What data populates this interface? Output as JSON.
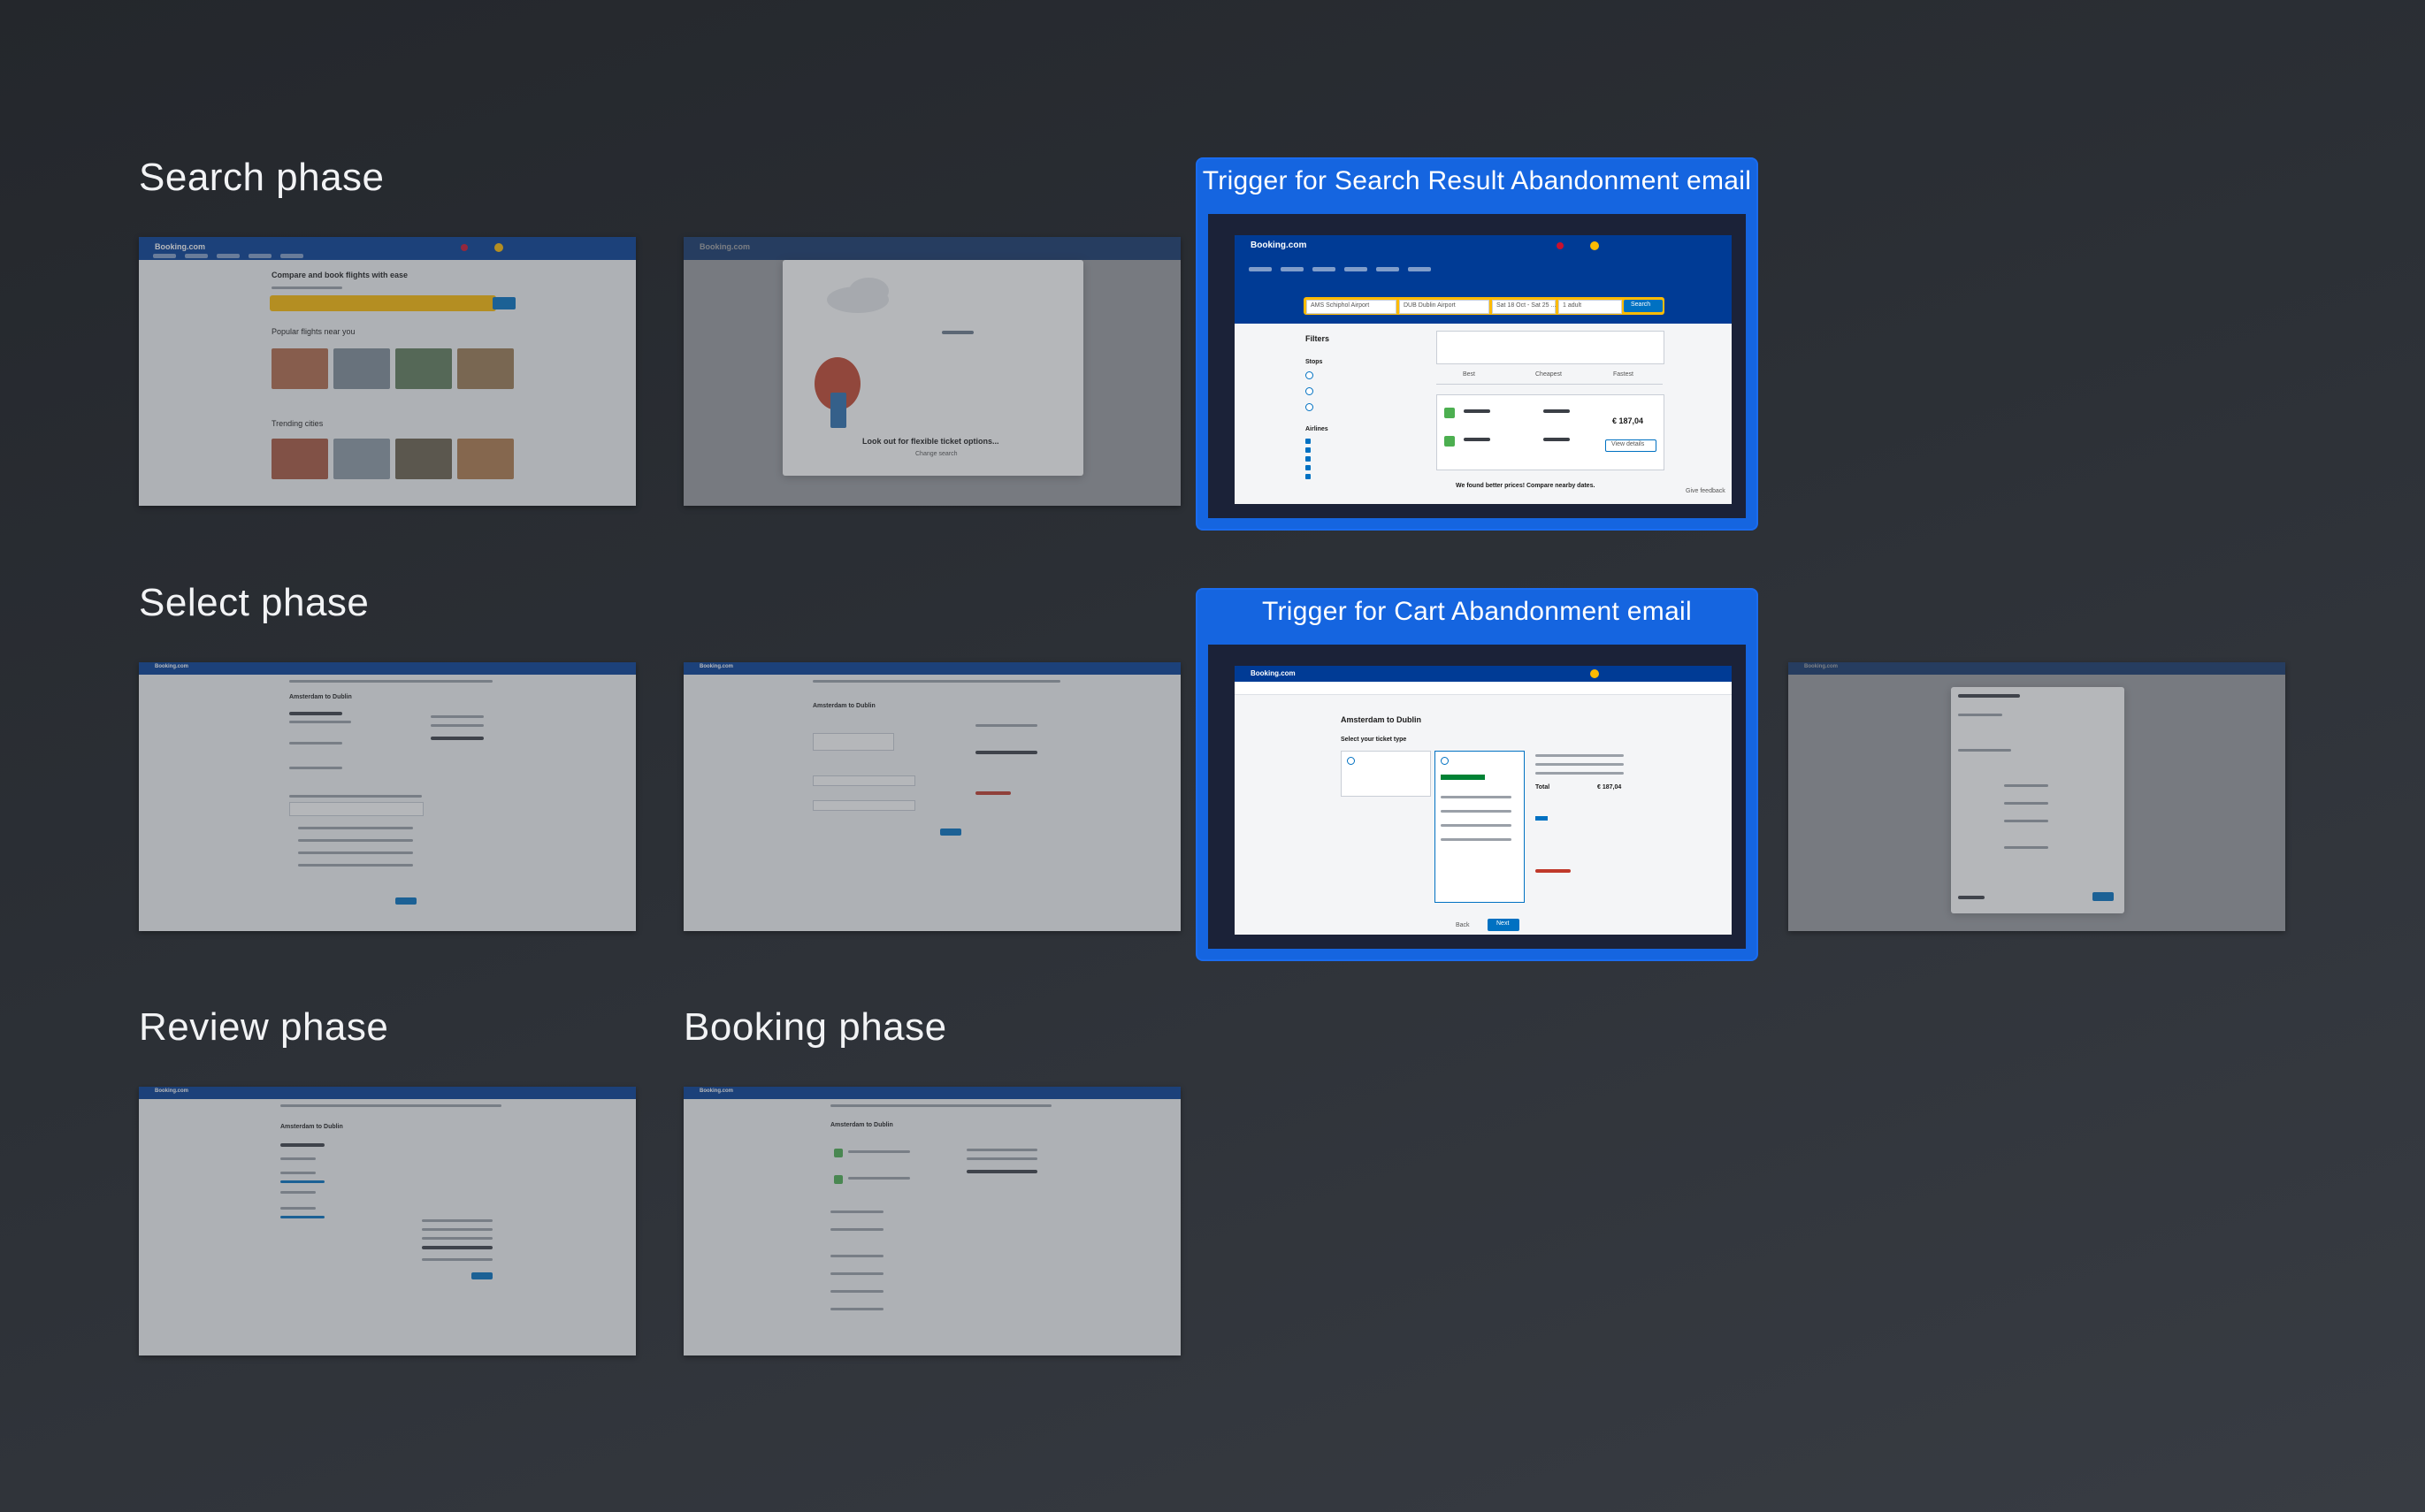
{
  "phases": {
    "search": "Search phase",
    "select": "Select phase",
    "review": "Review phase",
    "booking": "Booking phase"
  },
  "triggers": {
    "search_result": "Trigger for Search Result Abandonment email",
    "cart": "Trigger for Cart  Abandonment email"
  },
  "site": {
    "brand": "Booking.com"
  },
  "screens": {
    "home_heading": "Compare and book flights with ease",
    "popular": "Popular flights near you",
    "trending": "Trending cities",
    "modal_text": "Look out for flexible ticket options...",
    "modal_link": "Change search",
    "search_btn": "Search",
    "from": "AMS Schiphol Airport",
    "to": "DUB Dublin Airport",
    "dates": "Sat 18 Oct - Sat 25 ...",
    "pax": "1 adult",
    "filters": "Filters",
    "stops": "Stops",
    "airlines": "Airlines",
    "best": "Best",
    "cheapest": "Cheapest",
    "fastest": "Fastest",
    "price": "€ 187,04",
    "view_details": "View details",
    "nearby": "We found better prices! Compare nearby dates.",
    "route": "Amsterdam to Dublin",
    "ticket_type": "Select your ticket type",
    "total": "Total",
    "total_price": "€ 187,04",
    "next": "Next",
    "back": "Back",
    "gray_feedback": "Give feedback"
  },
  "colors": {
    "accent": "#1565e0",
    "brand_blue": "#003b95",
    "search_yellow": "#febb02"
  }
}
